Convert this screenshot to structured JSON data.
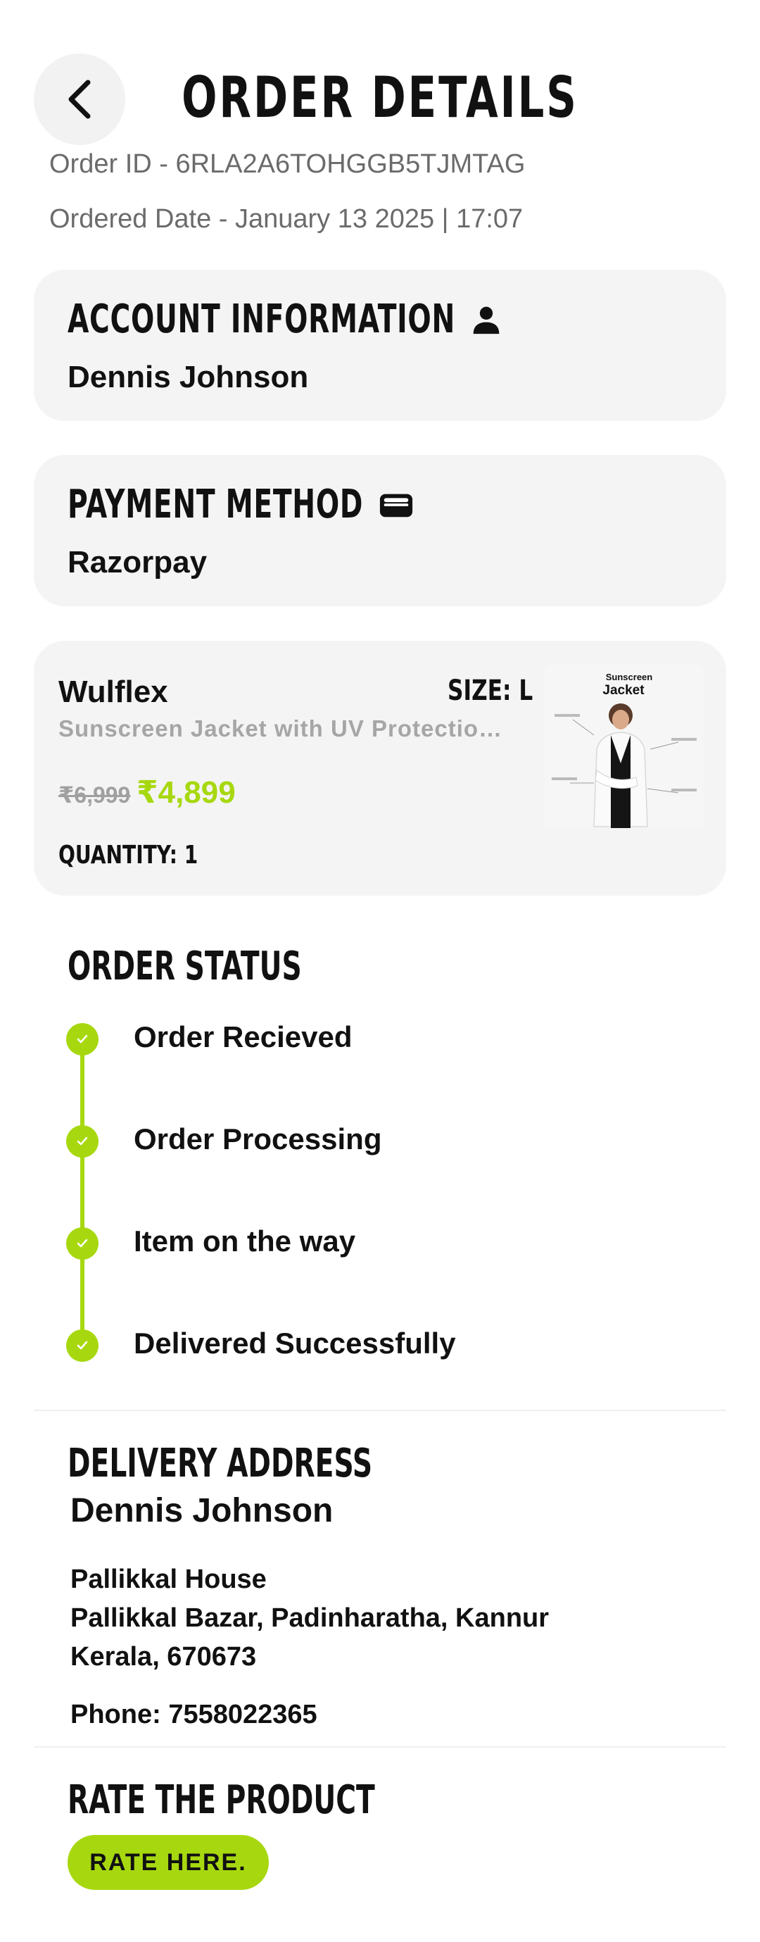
{
  "header": {
    "title": "ORDER DETAILS",
    "order_id": "Order ID - 6RLA2A6TOHGGB5TJMTAG",
    "ordered_date": "Ordered Date - January 13 2025 | 17:07"
  },
  "account": {
    "heading": "ACCOUNT INFORMATION",
    "icon": "person-icon",
    "name": "Dennis Johnson"
  },
  "payment": {
    "heading": "PAYMENT METHOD",
    "icon": "wallet-icon",
    "method": "Razorpay"
  },
  "product": {
    "brand": "Wulflex",
    "size": "SIZE: L",
    "description": "Sunscreen Jacket with UV Protection UPF 50+",
    "mrp": "₹6,999",
    "price": "₹4,899",
    "quantity": "QUANTITY: 1",
    "image_title_line1": "Sunscreen",
    "image_title_line2": "Jacket"
  },
  "order_status": {
    "heading": "ORDER STATUS",
    "steps": [
      {
        "label": "Order Recieved"
      },
      {
        "label": "Order Processing"
      },
      {
        "label": "Item on the way"
      },
      {
        "label": "Delivered Successfully"
      }
    ]
  },
  "delivery": {
    "heading": "DELIVERY ADDRESS",
    "name": "Dennis Johnson",
    "line1": "Pallikkal House",
    "line2": "Pallikkal Bazar, Padinharatha, Kannur",
    "line3": "Kerala, 670673",
    "phone": "Phone: 7558022365"
  },
  "rate": {
    "heading": "RATE THE PRODUCT",
    "button_label": "RATE HERE."
  },
  "colors": {
    "accent": "#a7d80f",
    "card_bg": "#f4f4f4"
  }
}
